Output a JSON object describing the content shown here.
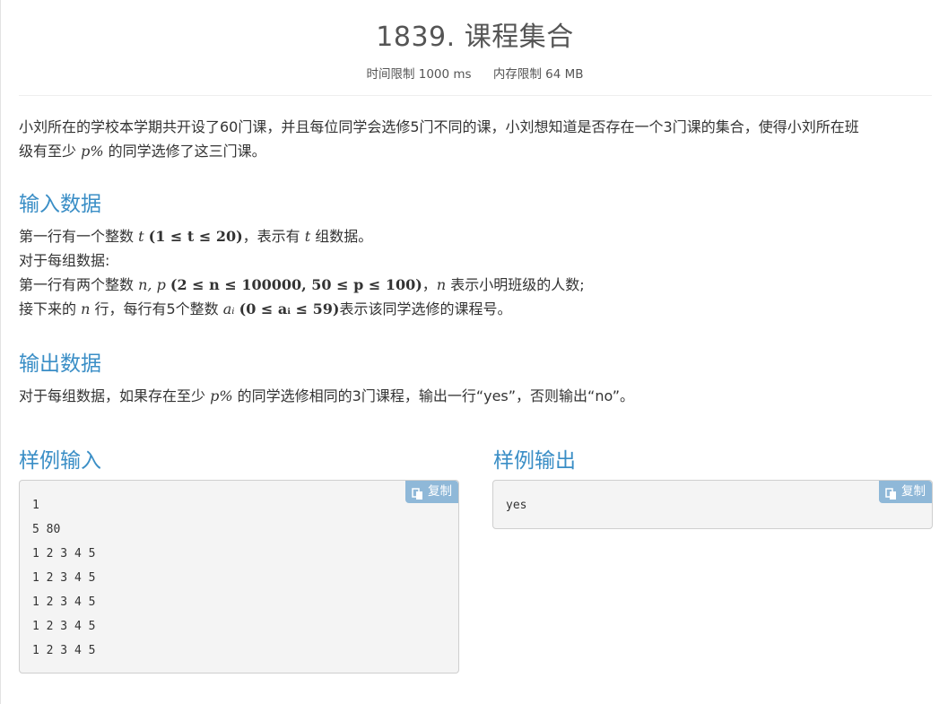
{
  "problem": {
    "title": "1839. 课程集合",
    "time_limit": "时间限制 1000 ms",
    "memory_limit": "内存限制 64 MB"
  },
  "description": {
    "line1": "小刘所在的学校本学期共开设了60门课，并且每位同学会选修5门不同的课，小刘想知道是否存在一个3门课的集合，使得小刘所在班",
    "line2_a": "级有至少 ",
    "line2_math": "p%",
    "line2_b": " 的同学选修了这三门课。"
  },
  "input_section": {
    "heading": "输入数据",
    "l1_a": "第一行有一个整数 ",
    "l1_m1": "t",
    "l1_m2": "(1 ≤ t ≤ 20)",
    "l1_b": "，表示有 ",
    "l1_m3": "t",
    "l1_c": " 组数据。",
    "l2": "对于每组数据:",
    "l3_a": "第一行有两个整数 ",
    "l3_m1": "n, p",
    "l3_m2": "(2 ≤ n ≤ 100000, 50 ≤ p ≤ 100)",
    "l3_b": "，",
    "l3_m3": "n",
    "l3_c": " 表示小明班级的人数;",
    "l4_a": "接下来的 ",
    "l4_m1": "n",
    "l4_b": " 行，每行有5个整数 ",
    "l4_m2": "aᵢ",
    "l4_m3": "(0 ≤ aᵢ ≤ 59)",
    "l4_c": "表示该同学选修的课程号。"
  },
  "output_section": {
    "heading": "输出数据",
    "l1_a": "对于每组数据，如果存在至少 ",
    "l1_m1": "p%",
    "l1_b": " 的同学选修相同的3门课程，输出一行“yes”，否则输出“no”。"
  },
  "sample_input": {
    "heading": "样例输入",
    "copy_label": "复制",
    "content": "1\n5 80\n1 2 3 4 5\n1 2 3 4 5\n1 2 3 4 5\n1 2 3 4 5\n1 2 3 4 5"
  },
  "sample_output": {
    "heading": "样例输出",
    "copy_label": "复制",
    "content": "yes"
  },
  "colors": {
    "heading": "#3a8ec6",
    "copy_button": "#8fb8d8"
  },
  "icons": {
    "copy": "copy-icon"
  }
}
